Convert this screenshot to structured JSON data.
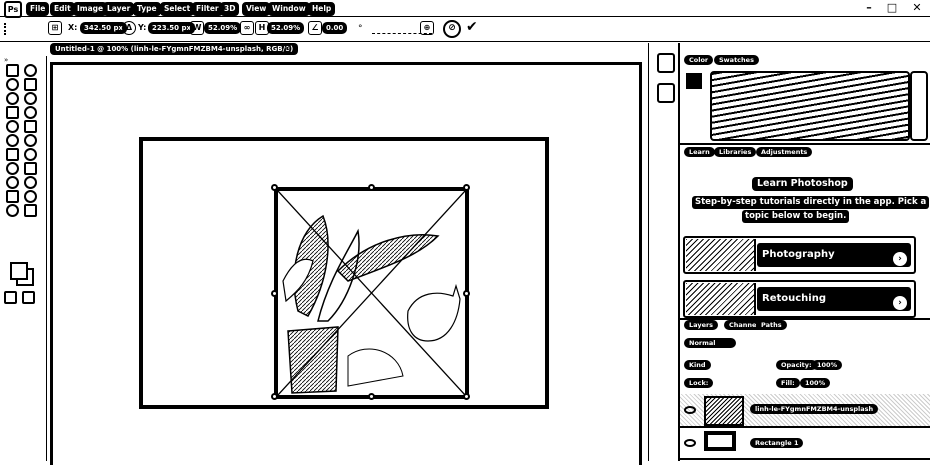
{
  "menubar": {
    "app_icon": "Ps",
    "items": [
      "File",
      "Edit",
      "Image",
      "Layer",
      "Type",
      "Select",
      "Filter",
      "3D",
      "View",
      "Window",
      "Help"
    ],
    "window_controls": [
      "–",
      "□",
      "✕"
    ]
  },
  "optionsbar": {
    "x_value": "342.50 px",
    "y_value": "223.50 px",
    "w_value": "52.09%",
    "h_value": "52.09%",
    "angle_value": "0.00",
    "check_label": "✔"
  },
  "document": {
    "tab_title": "Untitled-1 @ 100% (linh-le-FYgmnFMZBM4-unsplash, RGB/8)",
    "tab_close": "✕"
  },
  "panels": {
    "color_tab": "Color",
    "swatches_tab": "Swatches",
    "learn_tab": "Learn",
    "libraries_tab": "Libraries",
    "adjustments_tab": "Adjustments",
    "learn": {
      "title": "Learn Photoshop",
      "desc_line1": "Step-by-step tutorials directly in the app. Pick a",
      "desc_line2": "topic below to begin.",
      "cards": [
        {
          "label": "Photography"
        },
        {
          "label": "Retouching"
        }
      ]
    },
    "layers_tab": "Layers",
    "channels_tab": "Channels",
    "paths_tab": "Paths",
    "kind_filter": "Kind",
    "blend_mode": "Normal",
    "opacity_label": "Opacity:",
    "opacity_value": "100%",
    "lock_label": "Lock:",
    "fill_label": "Fill:",
    "fill_value": "100%",
    "layers": [
      {
        "name": "linh-le-FYgmnFMZBM4-unsplash"
      },
      {
        "name": "Rectangle 1"
      }
    ]
  },
  "colors": {
    "ink": "#000000",
    "paper": "#ffffff"
  }
}
